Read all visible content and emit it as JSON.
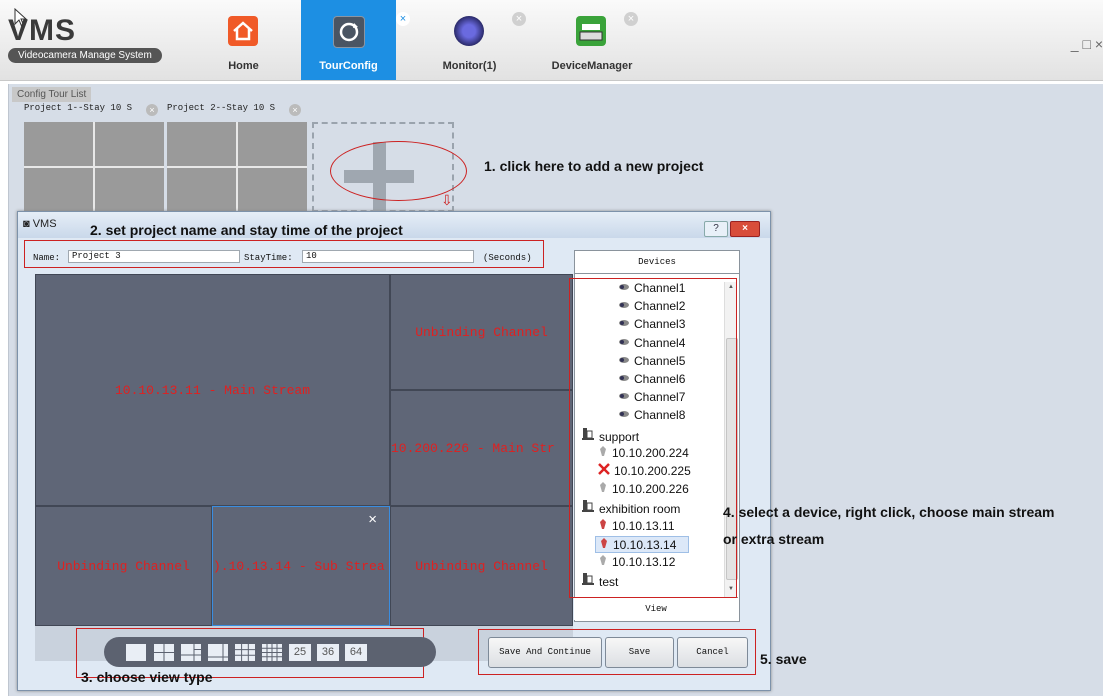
{
  "app": {
    "logo_title": "VMS",
    "logo_subtitle": "Videocamera Manage System",
    "window_controls": "_ □ ×"
  },
  "nav_tabs": [
    {
      "label": "Home",
      "icon": "home-icon",
      "closable": false,
      "active": false
    },
    {
      "label": "TourConfig",
      "icon": "refresh-icon",
      "closable": true,
      "active": true
    },
    {
      "label": "Monitor(1)",
      "icon": "camera-lens-icon",
      "closable": true,
      "active": false
    },
    {
      "label": "DeviceManager",
      "icon": "device-icon",
      "closable": true,
      "active": false
    }
  ],
  "tour_list": {
    "label": "Config Tour List",
    "projects": [
      "Project 1--Stay 10 S",
      "Project 2--Stay 10 S"
    ]
  },
  "notes": {
    "step1": "1. click here to add a new project",
    "step2": "2. set project name and stay time of the project",
    "step3": "3. choose view type",
    "step4_line1": "4. select a device, right click, choose main stream",
    "step4_line2": "or extra stream",
    "step5": "5. save"
  },
  "dialog": {
    "title": "VMS",
    "help_label": "?",
    "close_label": "×",
    "name_label": "Name:",
    "name_value": "Project 3",
    "stay_label": "StayTime:",
    "stay_value": "10",
    "seconds_label": "(Seconds)",
    "cells": {
      "big": "10.10.13.11 - Main Stream",
      "top_right": "Unbinding Channel",
      "mid_right": "10.200.226 - Main Str",
      "bottom_left": "Unbinding Channel",
      "bottom_mid": ").10.13.14 - Sub Strea",
      "bottom_right": "Unbinding Channel"
    },
    "cell_close": "×",
    "devices_header": "Devices",
    "view_button": "View",
    "tree": [
      {
        "label": "Channel1",
        "type": "channel"
      },
      {
        "label": "Channel2",
        "type": "channel"
      },
      {
        "label": "Channel3",
        "type": "channel"
      },
      {
        "label": "Channel4",
        "type": "channel"
      },
      {
        "label": "Channel5",
        "type": "channel"
      },
      {
        "label": "Channel6",
        "type": "channel"
      },
      {
        "label": "Channel7",
        "type": "channel"
      },
      {
        "label": "Channel8",
        "type": "channel"
      },
      {
        "label": "support",
        "type": "group"
      },
      {
        "label": "10.10.200.224",
        "type": "device"
      },
      {
        "label": "10.10.200.225",
        "type": "device-offline"
      },
      {
        "label": "10.10.200.226",
        "type": "device"
      },
      {
        "label": "exhibition room",
        "type": "group"
      },
      {
        "label": "10.10.13.11",
        "type": "device-active"
      },
      {
        "label": "10.10.13.14",
        "type": "device-selected"
      },
      {
        "label": "10.10.13.12",
        "type": "device"
      },
      {
        "label": "test",
        "type": "group"
      }
    ],
    "view_types": [
      "",
      "",
      "",
      "",
      "",
      "",
      "25",
      "36",
      "64"
    ],
    "buttons": {
      "save_continue": "Save And Continue",
      "save": "Save",
      "cancel": "Cancel"
    }
  },
  "colors": {
    "active_tab": "#1d8fe3",
    "annotation_red": "#cc2222",
    "cell_text": "#e02020",
    "cell_bg": "#5f6677"
  }
}
